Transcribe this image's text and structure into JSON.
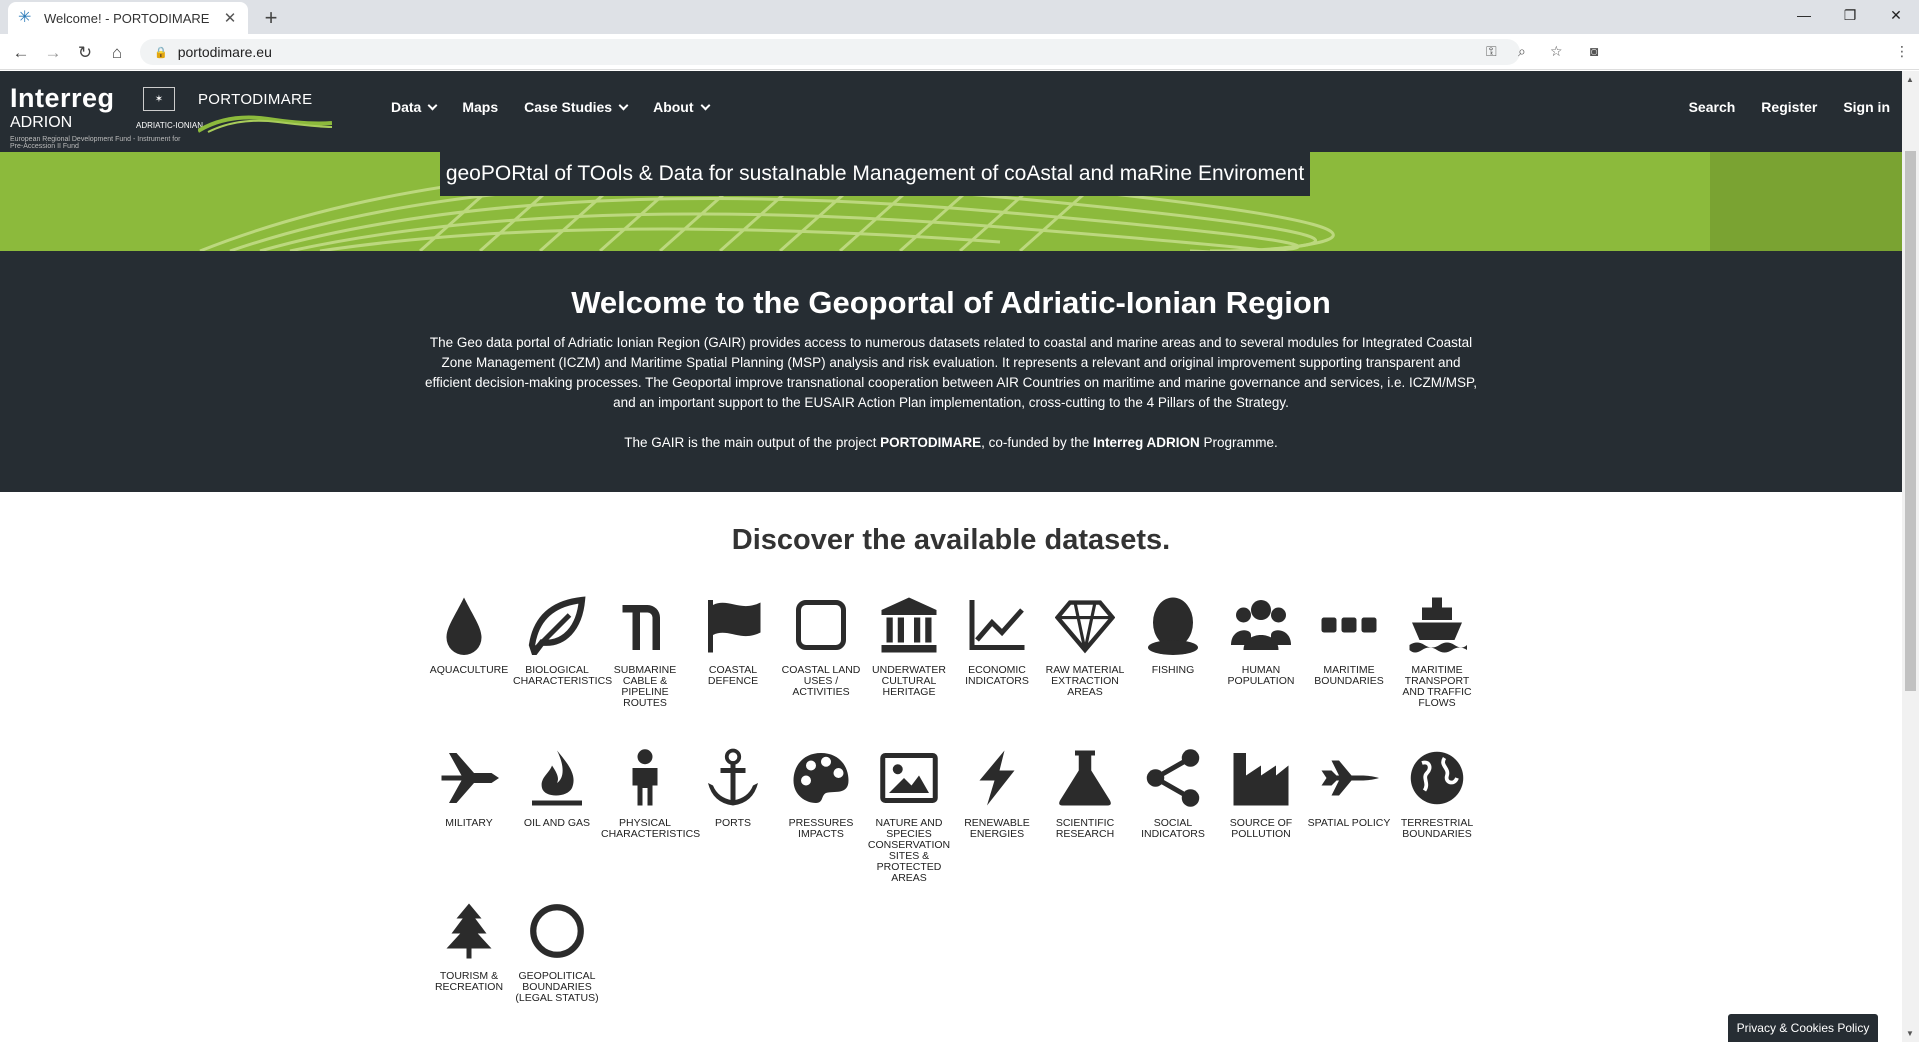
{
  "browser": {
    "tab_title": "Welcome! - PORTODIMARE",
    "url": "portodimare.eu"
  },
  "header": {
    "logo_interreg": "Interreg",
    "logo_adrion": "ADRION",
    "logo_adriatic_ionian": "ADRIATIC-IONIAN",
    "logo_fund": "European Regional Development Fund - Instrument for Pre-Accession II Fund",
    "logo_portodimare": "PORTODIMARE",
    "nav": [
      {
        "label": "Data",
        "has_dropdown": true
      },
      {
        "label": "Maps",
        "has_dropdown": false
      },
      {
        "label": "Case Studies",
        "has_dropdown": true
      },
      {
        "label": "About",
        "has_dropdown": true
      }
    ],
    "right_nav": [
      "Search",
      "Register",
      "Sign in"
    ]
  },
  "banner": {
    "tagline": "geoPORtal of TOols & Data for sustaInable Management of coAstal and maRine Enviroment"
  },
  "welcome": {
    "title": "Welcome to the Geoportal of Adriatic-Ionian Region",
    "paragraph": "The Geo data portal of Adriatic Ionian Region (GAIR) provides access to numerous datasets related to coastal and marine areas and to several modules for Integrated Coastal Zone Management (ICZM) and Maritime Spatial Planning (MSP) analysis and risk evaluation. It represents a relevant and original improvement supporting transparent and efficient decision-making processes. The Geoportal improve transnational cooperation between AIR Countries on maritime and marine governance and services, i.e. ICZM/MSP, and an important support to the EUSAIR Action Plan implementation, cross-cutting to the 4 Pillars of the Strategy.",
    "line2_pre": "The GAIR is the main output of the project ",
    "line2_project": "PORTODIMARE",
    "line2_mid": ", co-funded by the ",
    "line2_programme": "Interreg ADRION",
    "line2_post": " Programme."
  },
  "datasets": {
    "title": "Discover the available datasets.",
    "items": [
      {
        "label": "AQUACULTURE",
        "icon": "droplet-icon"
      },
      {
        "label": "BIOLOGICAL CHARACTERISTICS",
        "icon": "leaf-icon"
      },
      {
        "label": "SUBMARINE CABLE & PIPELINE ROUTES",
        "icon": "pipeline-icon"
      },
      {
        "label": "COASTAL DEFENCE",
        "icon": "flag-icon"
      },
      {
        "label": "COASTAL LAND USES / ACTIVITIES",
        "icon": "square-icon"
      },
      {
        "label": "UNDERWATER CULTURAL HERITAGE",
        "icon": "museum-icon"
      },
      {
        "label": "ECONOMIC INDICATORS",
        "icon": "line-chart-icon"
      },
      {
        "label": "RAW MATERIAL EXTRACTION AREAS",
        "icon": "diamond-icon"
      },
      {
        "label": "FISHING",
        "icon": "linux-icon"
      },
      {
        "label": "HUMAN POPULATION",
        "icon": "users-icon"
      },
      {
        "label": "MARITIME BOUNDARIES",
        "icon": "ellipsis-icon"
      },
      {
        "label": "MARITIME TRANSPORT AND TRAFFIC FLOWS",
        "icon": "ship-icon"
      },
      {
        "label": "MILITARY",
        "icon": "fighter-jet-icon"
      },
      {
        "label": "OIL AND GAS",
        "icon": "fire-icon"
      },
      {
        "label": "PHYSICAL CHARACTERISTICS",
        "icon": "person-icon"
      },
      {
        "label": "PORTS",
        "icon": "anchor-icon"
      },
      {
        "label": "PRESSURES IMPACTS",
        "icon": "palette-icon"
      },
      {
        "label": "NATURE AND SPECIES CONSERVATION SITES & PROTECTED AREAS",
        "icon": "image-icon"
      },
      {
        "label": "RENEWABLE ENERGIES",
        "icon": "bolt-icon"
      },
      {
        "label": "SCIENTIFIC RESEARCH",
        "icon": "flask-icon"
      },
      {
        "label": "SOCIAL INDICATORS",
        "icon": "share-icon"
      },
      {
        "label": "SOURCE OF POLLUTION",
        "icon": "factory-icon"
      },
      {
        "label": "SPATIAL POLICY",
        "icon": "space-shuttle-icon"
      },
      {
        "label": "TERRESTRIAL BOUNDARIES",
        "icon": "globe-icon"
      },
      {
        "label": "TOURISM & RECREATION",
        "icon": "tree-icon"
      },
      {
        "label": "GEOPOLITICAL BOUNDARIES (LEGAL STATUS)",
        "icon": "circle-icon"
      }
    ]
  },
  "footer": {
    "privacy": "Privacy & Cookies Policy"
  }
}
